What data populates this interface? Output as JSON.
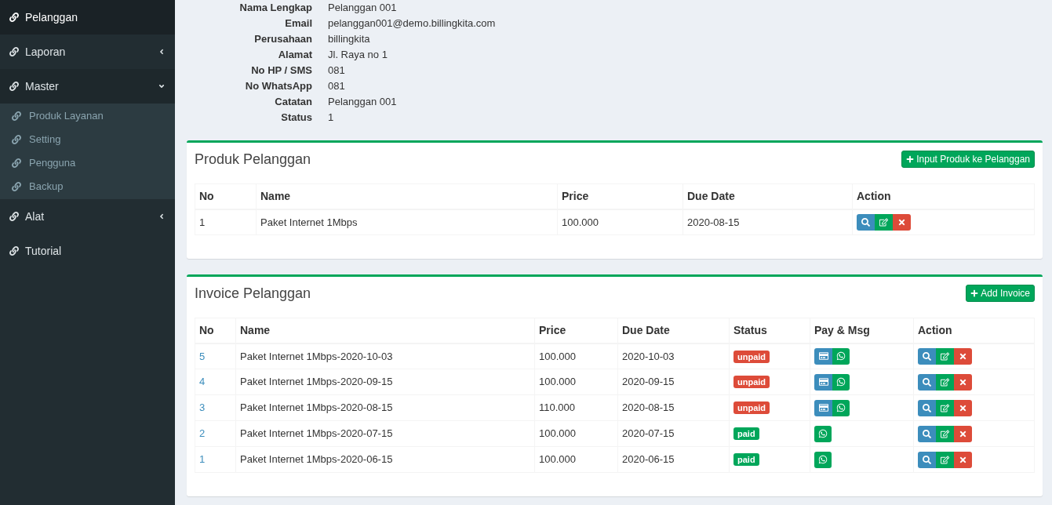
{
  "sidebar": {
    "items": [
      {
        "label": "Pelanggan",
        "selected": true
      },
      {
        "label": "Laporan",
        "selected": false,
        "expanded": false
      },
      {
        "label": "Master",
        "selected": false,
        "expanded": true,
        "children": [
          {
            "label": "Produk Layanan"
          },
          {
            "label": "Setting"
          },
          {
            "label": "Pengguna"
          },
          {
            "label": "Backup"
          }
        ]
      },
      {
        "label": "Alat",
        "selected": false,
        "expanded": false
      },
      {
        "label": "Tutorial",
        "selected": false
      }
    ]
  },
  "details": [
    {
      "label": "Nama Lengkap",
      "value": "Pelanggan 001"
    },
    {
      "label": "Email",
      "value": "pelanggan001@demo.billingkita.com"
    },
    {
      "label": "Perusahaan",
      "value": "billingkita"
    },
    {
      "label": "Alamat",
      "value": "Jl. Raya no 1"
    },
    {
      "label": "No HP / SMS",
      "value": "081"
    },
    {
      "label": "No WhatsApp",
      "value": "081"
    },
    {
      "label": "Catatan",
      "value": "Pelanggan 001"
    },
    {
      "label": "Status",
      "value": "1"
    }
  ],
  "products": {
    "title": "Produk Pelanggan",
    "add_button": "Input Produk ke Pelanggan",
    "columns": [
      "No",
      "Name",
      "Price",
      "Due Date",
      "Action"
    ],
    "rows": [
      {
        "no": "1",
        "name": "Paket Internet 1Mbps",
        "price": "100.000",
        "due": "2020-08-15"
      }
    ]
  },
  "invoices": {
    "title": "Invoice Pelanggan",
    "add_button": "Add Invoice",
    "columns": [
      "No",
      "Name",
      "Price",
      "Due Date",
      "Status",
      "Pay & Msg",
      "Action"
    ],
    "rows": [
      {
        "no": "5",
        "name": "Paket Internet 1Mbps-2020-10-03",
        "price": "100.000",
        "due": "2020-10-03",
        "status": {
          "kind": "unpaid",
          "label": "unpaid"
        }
      },
      {
        "no": "4",
        "name": "Paket Internet 1Mbps-2020-09-15",
        "price": "100.000",
        "due": "2020-09-15",
        "status": {
          "kind": "unpaid",
          "label": "unpaid"
        }
      },
      {
        "no": "3",
        "name": "Paket Internet 1Mbps-2020-08-15",
        "price": "110.000",
        "due": "2020-08-15",
        "status": {
          "kind": "unpaid",
          "label": "unpaid"
        }
      },
      {
        "no": "2",
        "name": "Paket Internet 1Mbps-2020-07-15",
        "price": "100.000",
        "due": "2020-07-15",
        "status": {
          "kind": "paid",
          "label": "paid"
        }
      },
      {
        "no": "1",
        "name": "Paket Internet 1Mbps-2020-06-15",
        "price": "100.000",
        "due": "2020-06-15",
        "status": {
          "kind": "paid",
          "label": "paid"
        }
      }
    ]
  }
}
